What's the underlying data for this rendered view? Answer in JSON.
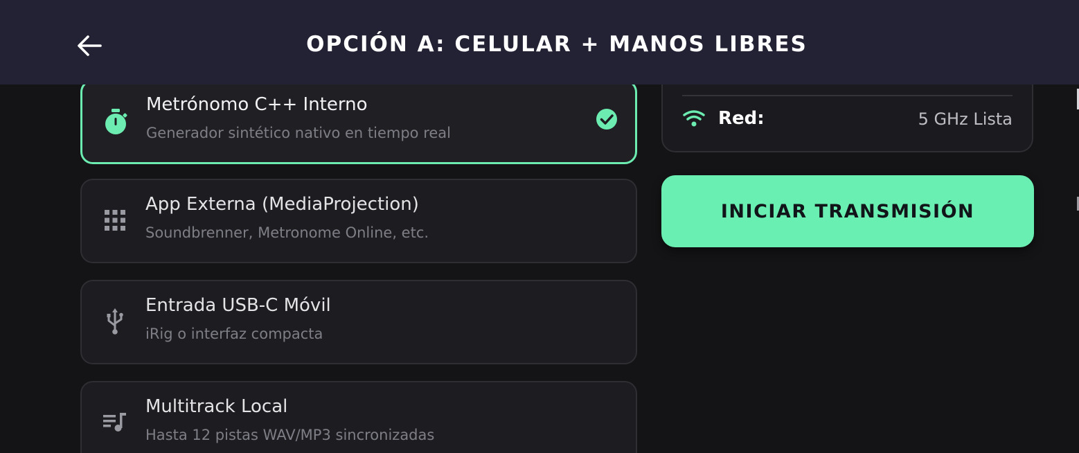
{
  "header": {
    "title": "OPCIÓN A: CELULAR + MANOS LIBRES",
    "back_icon": "arrow-left-icon"
  },
  "options": [
    {
      "title": "Metrónomo C++ Interno",
      "subtitle": "Generador sintético nativo en tiempo real",
      "icon": "stopwatch-icon",
      "selected": true
    },
    {
      "title": "App Externa (MediaProjection)",
      "subtitle": "Soundbrenner, Metronome Online, etc.",
      "icon": "apps-grid-icon",
      "selected": false
    },
    {
      "title": "Entrada USB-C Móvil",
      "subtitle": "iRig o interfaz compacta",
      "icon": "usb-icon",
      "selected": false
    },
    {
      "title": "Multitrack Local",
      "subtitle": "Hasta 12 pistas WAV/MP3 sincronizadas",
      "icon": "playlist-music-icon",
      "selected": false
    }
  ],
  "network": {
    "label": "Red:",
    "value": "5 GHz Lista",
    "icon": "wifi-icon"
  },
  "start_button": {
    "label": "INICIAR TRANSMISIÓN"
  },
  "colors": {
    "accent": "#6aefb2",
    "header_bg": "#222234",
    "page_bg": "#141416",
    "card_bg": "#1d1d21"
  }
}
